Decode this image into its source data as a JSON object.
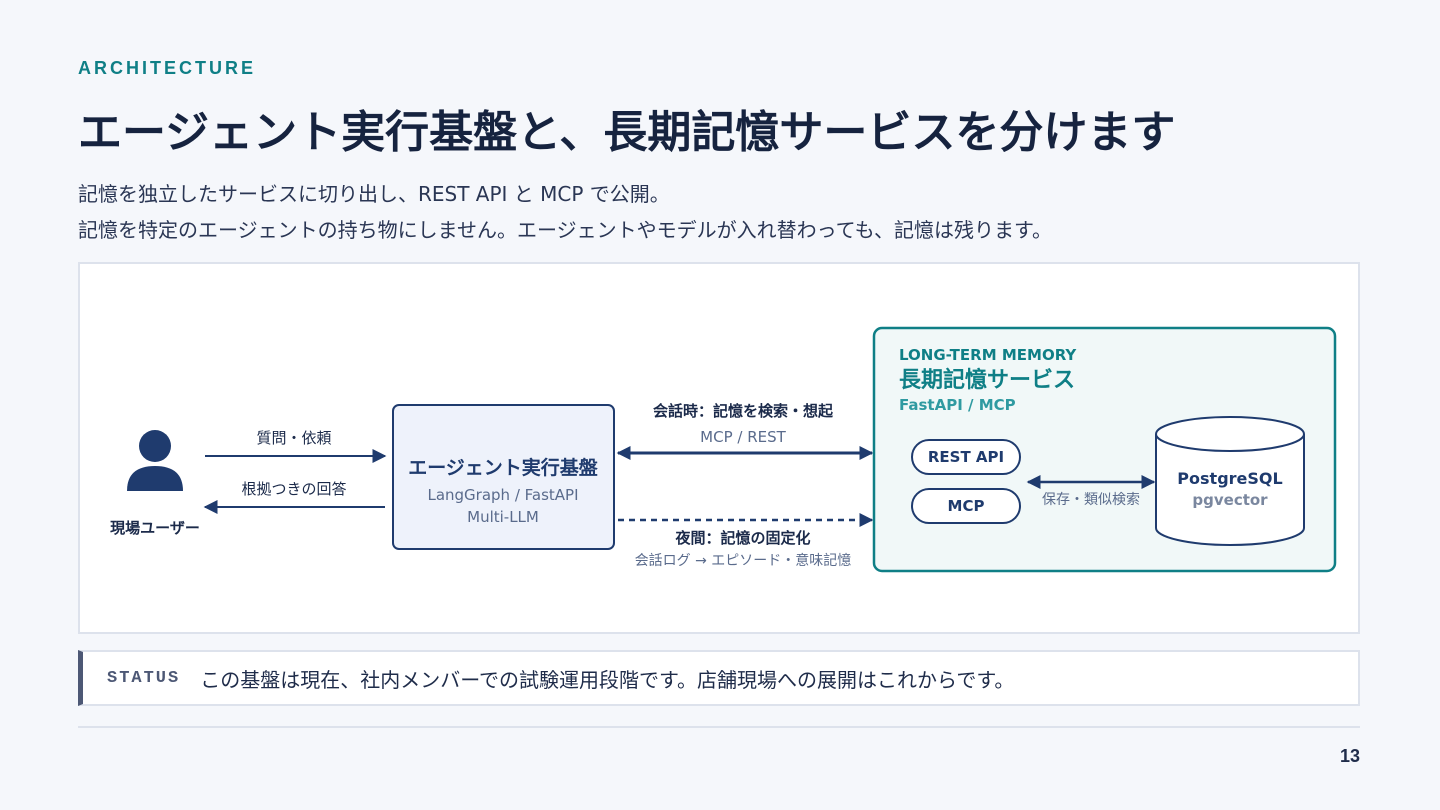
{
  "header": {
    "eyebrow": "ARCHITECTURE",
    "title": "エージェント実行基盤と、長期記憶サービスを分けます",
    "lead_line1": "記憶を独立したサービスに切り出し、REST API と MCP で公開。",
    "lead_line2": "記憶を特定のエージェントの持ち物にしません。エージェントやモデルが入れ替わっても、記憶は残ります。"
  },
  "diagram": {
    "user": {
      "label": "現場ユーザー",
      "icon": "person-icon",
      "arrow_to_agent": "質問・依頼",
      "arrow_from_agent": "根拠つきの回答"
    },
    "agent": {
      "title": "エージェント実行基盤",
      "sub1": "LangGraph / FastAPI",
      "sub2": "Multi-LLM"
    },
    "sync_arrow": {
      "label": "会話時：記憶を検索・想起",
      "sub": "MCP / REST"
    },
    "nightly_arrow": {
      "label": "夜間：記憶の固定化",
      "sub": "会話ログ → エピソード・意味記憶"
    },
    "memory_service": {
      "eyebrow": "LONG-TERM MEMORY",
      "title": "長期記憶サービス",
      "sub": "FastAPI / MCP",
      "rest_pill": "REST API",
      "mcp_pill": "MCP",
      "store_arrow": "保存・類似検索",
      "db_title": "PostgreSQL",
      "db_sub": "pgvector"
    },
    "colors": {
      "navy": "#1f3b6e",
      "teal": "#0f7f86",
      "agent_fill": "#eef2fb",
      "memory_fill": "#f1f8f8"
    }
  },
  "status": {
    "tag": "STATUS",
    "text": "この基盤は現在、社内メンバーでの試験運用段階です。店舗現場への展開はこれからです。"
  },
  "page_number": "13"
}
